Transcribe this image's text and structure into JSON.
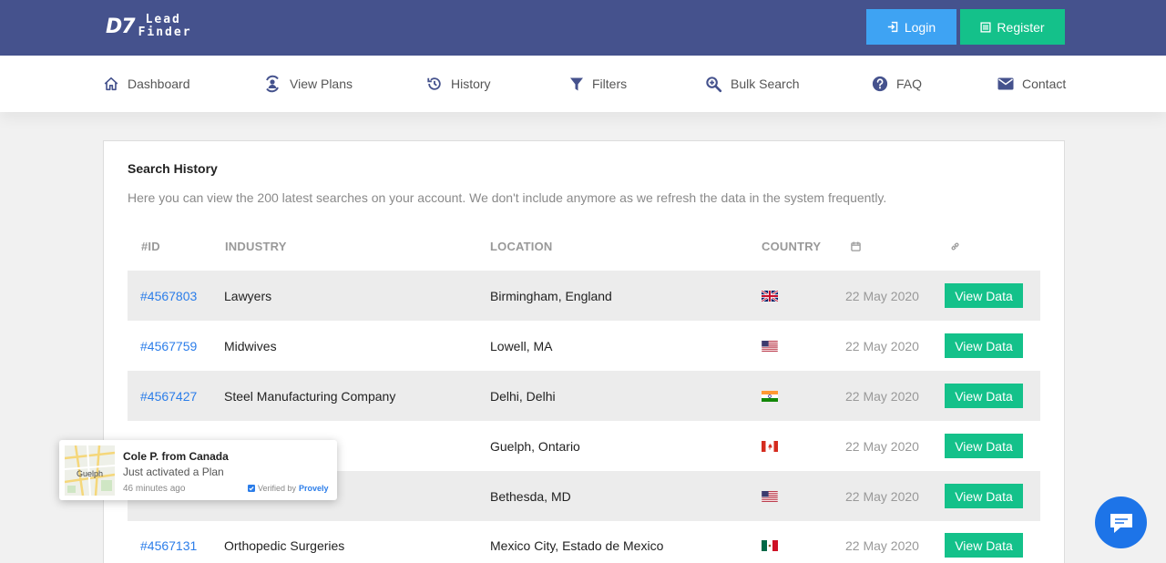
{
  "brand": {
    "mark": "D7",
    "line1": "Lead",
    "line2": "Finder"
  },
  "auth": {
    "login_label": "Login",
    "register_label": "Register"
  },
  "nav": {
    "items": [
      {
        "label": "Dashboard",
        "icon": "home-icon"
      },
      {
        "label": "View Plans",
        "icon": "plans-icon"
      },
      {
        "label": "History",
        "icon": "history-icon"
      },
      {
        "label": "Filters",
        "icon": "filter-icon"
      },
      {
        "label": "Bulk Search",
        "icon": "search-plus-icon"
      },
      {
        "label": "FAQ",
        "icon": "question-icon"
      },
      {
        "label": "Contact",
        "icon": "envelope-icon"
      }
    ]
  },
  "history": {
    "title": "Search History",
    "description": "Here you can view the 200 latest searches on your account. We don't include anymore as we refresh the data in the system frequently.",
    "columns": {
      "id": "#ID",
      "industry": "INDUSTRY",
      "location": "LOCATION",
      "country": "COUNTRY",
      "date_icon": "calendar-icon",
      "link_icon": "link-icon"
    },
    "view_label": "View Data",
    "rows": [
      {
        "id": "#4567803",
        "industry": "Lawyers",
        "location": "Birmingham, England",
        "flag": "uk-flag-icon",
        "date": "22 May 2020"
      },
      {
        "id": "#4567759",
        "industry": "Midwives",
        "location": "Lowell, MA",
        "flag": "us-flag-icon",
        "date": "22 May 2020"
      },
      {
        "id": "#4567427",
        "industry": "Steel Manufacturing Company",
        "location": "Delhi, Delhi",
        "flag": "india-flag-icon",
        "date": "22 May 2020"
      },
      {
        "id": "",
        "industry": "",
        "location": "Guelph, Ontario",
        "flag": "canada-flag-icon",
        "date": "22 May 2020"
      },
      {
        "id": "",
        "industry": "",
        "location": "Bethesda, MD",
        "flag": "us-flag-icon",
        "date": "22 May 2020"
      },
      {
        "id": "#4567131",
        "industry": "Orthopedic Surgeries",
        "location": "Mexico City, Estado de Mexico",
        "flag": "mexico-flag-icon",
        "date": "22 May 2020"
      }
    ]
  },
  "notification": {
    "map_label": "Guelph",
    "name": "Cole P. from Canada",
    "action": "Just activated a Plan",
    "time": "46 minutes ago",
    "verified_prefix": "Verified by",
    "verified_brand": "Provely"
  },
  "chat": {
    "icon": "chat-bubble-icon"
  },
  "colors": {
    "header": "#45528d",
    "login": "#3ea3f3",
    "accent_green": "#14c18a",
    "link_blue": "#2b7de9"
  }
}
